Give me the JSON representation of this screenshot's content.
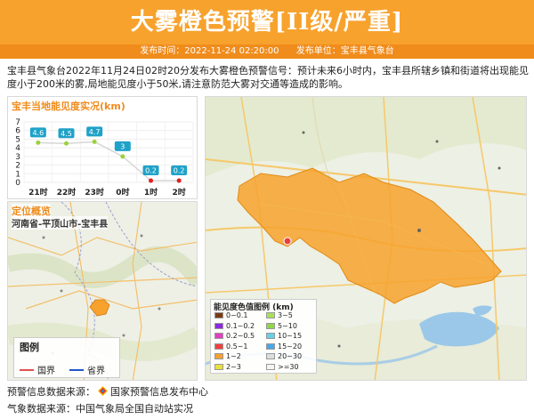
{
  "header": {
    "title": "大雾橙色预警[II级/严重]",
    "publish_time": "发布时间：2022-11-24 02:20:00",
    "publisher": "发布单位：宝丰县气象台"
  },
  "summary": "宝丰县气象台2022年11月24日02时20分发布大雾橙色预警信号：预计未来6小时内，宝丰县所辖乡镇和街道将出现能见度小于200米的雾,局地能见度小于50米,请注意防范大雾对交通等造成的影响。",
  "chart_panel": {
    "title": "宝丰当地能见度实况(km)"
  },
  "chart_data": {
    "type": "line",
    "title": "宝丰当地能见度实况(km)",
    "categories": [
      "21时",
      "22时",
      "23时",
      "0时",
      "1时",
      "2时"
    ],
    "values": [
      4.6,
      4.5,
      4.7,
      3,
      0.2,
      0.2
    ],
    "data_labels": [
      "4.6",
      "4.5",
      "4.7",
      "3",
      "0.2",
      "0.2"
    ],
    "y_ticks": [
      "0",
      "1",
      "2",
      "3",
      "4",
      "5",
      "6",
      "7"
    ],
    "ylim": [
      0,
      7
    ],
    "grid": true
  },
  "location": {
    "title": "定位概览",
    "region": "河南省-平顶山市-宝丰县",
    "legend_title": "图例",
    "legend_items": [
      {
        "label": "国界",
        "color": "#e05050"
      },
      {
        "label": "省界",
        "color": "#2255cc"
      }
    ]
  },
  "visibility_legend": {
    "title": "能见度色值图例 (km)",
    "items": [
      {
        "label": "0~0.1",
        "color": "#7a3a12"
      },
      {
        "label": "3~5",
        "color": "#a8e05a"
      },
      {
        "label": "0.1~0.2",
        "color": "#8a2be2"
      },
      {
        "label": "5~10",
        "color": "#8fd64a"
      },
      {
        "label": "0.2~0.5",
        "color": "#e040c0"
      },
      {
        "label": "10~15",
        "color": "#66d0e8"
      },
      {
        "label": "0.5~1",
        "color": "#f04040"
      },
      {
        "label": "15~20",
        "color": "#4aa8e8"
      },
      {
        "label": "1~2",
        "color": "#f5a030"
      },
      {
        "label": "20~30",
        "color": "#dddddd"
      },
      {
        "label": "2~3",
        "color": "#e8e040"
      },
      {
        "label": ">=30",
        "color": "#f4f4f4"
      }
    ]
  },
  "footer": {
    "warning_source_label": "预警信息数据来源：",
    "warning_source": "国家预警信息发布中心",
    "weather_source": "气象数据来源：中国气象局全国自动站实况"
  },
  "colors": {
    "header": "#f7a22d",
    "header_bar": "#f08c1c",
    "warning_area": "#f7a22d",
    "label_box": "#1fa2c8"
  }
}
